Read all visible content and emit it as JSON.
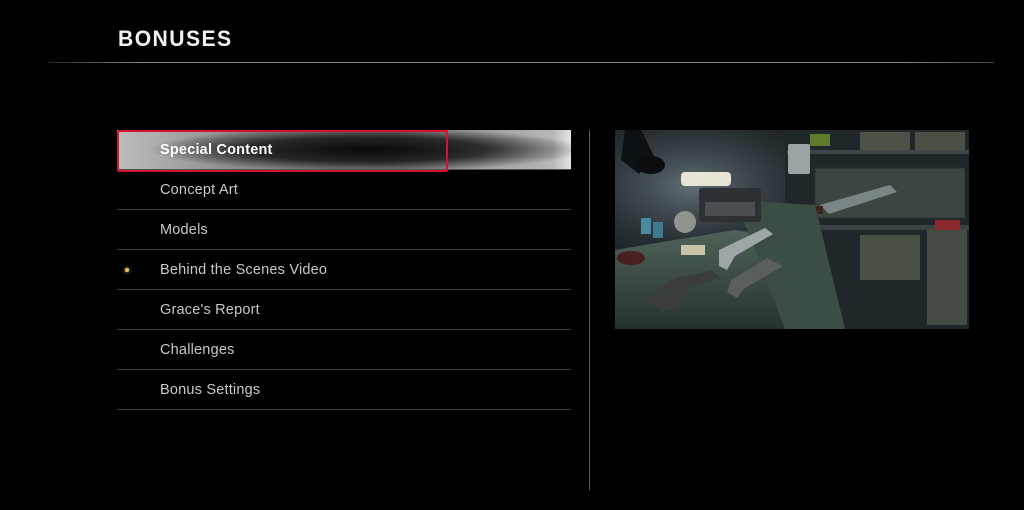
{
  "header": {
    "title": "BONUSES"
  },
  "menu": {
    "items": [
      {
        "label": "Special Content",
        "selected": true,
        "new": false
      },
      {
        "label": "Concept Art",
        "selected": false,
        "new": false
      },
      {
        "label": "Models",
        "selected": false,
        "new": false
      },
      {
        "label": "Behind the Scenes Video",
        "selected": false,
        "new": true
      },
      {
        "label": "Grace's Report",
        "selected": false,
        "new": false
      },
      {
        "label": "Challenges",
        "selected": false,
        "new": false
      },
      {
        "label": "Bonus Settings",
        "selected": false,
        "new": false
      }
    ]
  },
  "colors": {
    "highlight": "#d3142c",
    "new_indicator": "#e8c55a"
  }
}
